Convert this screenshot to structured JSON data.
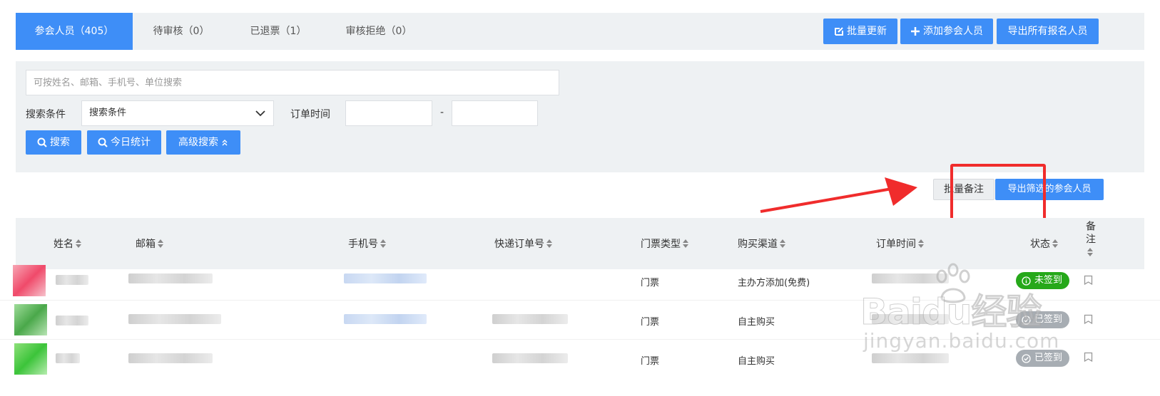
{
  "tabs": [
    {
      "label": "参会人员（405）",
      "active": true
    },
    {
      "label": "待审核（0）",
      "active": false
    },
    {
      "label": "已退票（1）",
      "active": false
    },
    {
      "label": "审核拒绝（0）",
      "active": false
    }
  ],
  "toolbar": {
    "batch_update": "批量更新",
    "add_attendee": "添加参会人员",
    "export_all": "导出所有报名人员"
  },
  "search": {
    "placeholder": "可按姓名、邮箱、手机号、单位搜索",
    "condition_label": "搜索条件",
    "condition_value": "搜索条件",
    "order_time_label": "订单时间",
    "range_sep": "-",
    "search_btn": "搜索",
    "today_btn": "今日统计",
    "advanced_btn": "高级搜索"
  },
  "actions": {
    "batch_note": "批量备注",
    "export_filtered": "导出筛选的参会人员"
  },
  "table": {
    "headers": {
      "name": "姓名",
      "email": "邮箱",
      "phone": "手机号",
      "express": "快递订单号",
      "ticket_type": "门票类型",
      "channel": "购买渠道",
      "order_time": "订单时间",
      "status": "状态",
      "note": "备注"
    },
    "rows": [
      {
        "ticket_type": "门票",
        "channel": "主办方添加(免费)",
        "status": "未签到",
        "status_color": "#26a81a"
      },
      {
        "ticket_type": "门票",
        "channel": "自主购买",
        "status": "已签到",
        "status_color": "#a7adb3"
      },
      {
        "ticket_type": "门票",
        "channel": "自主购买",
        "status": "已签到",
        "status_color": "#a7adb3"
      }
    ]
  },
  "watermark": {
    "brand": "Baidu经验",
    "url": "jingyan.baidu.com"
  },
  "colors": {
    "accent": "#3e8ef7",
    "annotation": "#f02c2c",
    "panel_bg": "#eef1f3"
  }
}
